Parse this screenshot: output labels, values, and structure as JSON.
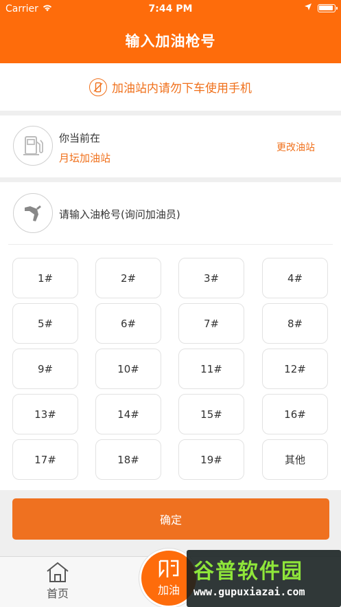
{
  "status": {
    "carrier": "Carrier",
    "time": "7:44 PM"
  },
  "nav": {
    "title": "输入加油枪号"
  },
  "notice": {
    "text": "加油站内请勿下车使用手机",
    "icon": "no-phone-icon"
  },
  "station": {
    "label": "你当前在",
    "name": "月坛加油站",
    "change": "更改油站",
    "icon": "fuel-pump-icon"
  },
  "pump": {
    "prompt": "请输入油枪号(询问加油员)",
    "icon": "fuel-nozzle-icon",
    "options": [
      "1#",
      "2#",
      "3#",
      "4#",
      "5#",
      "6#",
      "7#",
      "8#",
      "9#",
      "10#",
      "11#",
      "12#",
      "13#",
      "14#",
      "15#",
      "16#",
      "17#",
      "18#",
      "19#",
      "其他"
    ]
  },
  "actions": {
    "confirm": "确定"
  },
  "tabs": {
    "home": "首页",
    "refuel": "加油"
  },
  "watermark": {
    "title": "谷普软件园",
    "url": "www.gupuxiazai.com"
  },
  "colors": {
    "brand": "#fe6c0b",
    "accent": "#f0701b"
  }
}
